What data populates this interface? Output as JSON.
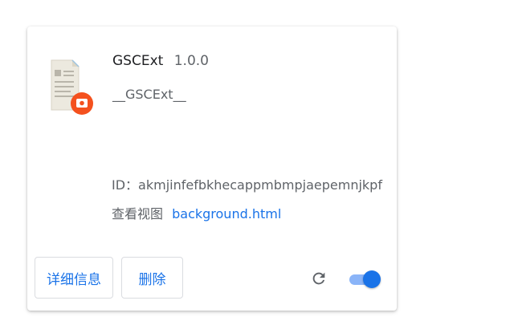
{
  "extension": {
    "name": "GSCExt",
    "version": "1.0.0",
    "description": "__GSCExt__",
    "id_text": "ID：akmjinfefbkhecappmbmpjaepemnjkpf",
    "views_label": "查看视图",
    "views_link": "background.html",
    "enabled": true
  },
  "buttons": {
    "details": "详细信息",
    "remove": "删除"
  },
  "icons": {
    "extension": "document-with-badge-icon",
    "reload": "reload-icon"
  },
  "colors": {
    "accent": "#1a73e8",
    "toggle_track": "#8ab4f8",
    "badge": "#f4511e",
    "secondary_text": "#5f6368"
  }
}
